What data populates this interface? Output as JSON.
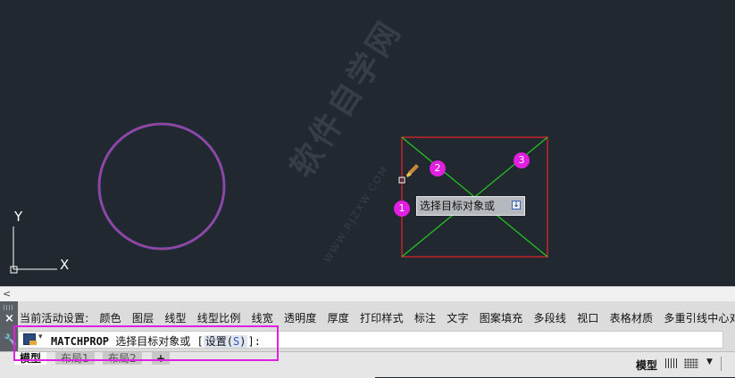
{
  "canvas": {
    "background": "#212830",
    "ucs": {
      "x_label": "X",
      "y_label": "Y"
    },
    "tooltip_text": "选择目标对象或",
    "badges": [
      "1",
      "2",
      "3"
    ],
    "watermark": "软件自学网",
    "watermark_url": "WWW.RJZXW.COM",
    "colors": {
      "selection_box": "#c0262b",
      "diagonals": "#23c223",
      "circle": "#6b4fc8",
      "badge": "#e01fe0"
    }
  },
  "scrollbar": {
    "left_arrow": "<"
  },
  "command": {
    "history_label": "当前活动设置:",
    "history_items": [
      "颜色",
      "图层",
      "线型",
      "线型比例",
      "线宽",
      "透明度",
      "厚度",
      "打印样式",
      "标注",
      "文字",
      "图案填充",
      "多段线",
      "视口",
      "表格材质",
      "多重引线中心对象"
    ],
    "command_name": "MATCHPROP",
    "prompt": "选择目标对象或",
    "option_open": "[",
    "option_label": "设置",
    "option_key_open": "(",
    "option_key": "S",
    "option_key_close": ")",
    "option_close": "]:",
    "close_icon": "×"
  },
  "tabs": [
    "模型",
    "布局1",
    "布局2"
  ],
  "add_tab": "+",
  "status": {
    "model_label": "模型"
  }
}
